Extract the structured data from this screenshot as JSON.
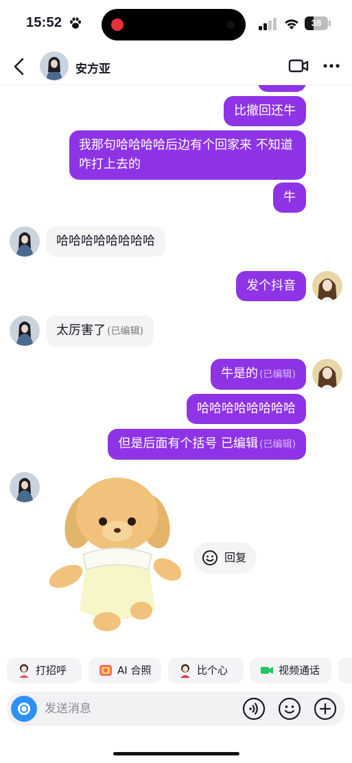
{
  "status_bar": {
    "time": "15:52",
    "battery": "38",
    "battery_fraction": 0.38
  },
  "header": {
    "contact_name": "安方亚",
    "back_icon": "chevron-left-icon",
    "video_icon": "video-camera-icon",
    "more_icon": "more-dots-icon"
  },
  "messages": [
    {
      "side": "sent",
      "text": "比撤回还牛"
    },
    {
      "side": "sent",
      "text": "我那句哈哈哈哈后边有个回家来 不知道咋打上去的"
    },
    {
      "side": "sent",
      "text": "牛"
    },
    {
      "side": "recv",
      "text": "哈哈哈哈哈哈哈哈"
    },
    {
      "side": "sent",
      "text": "发个抖音"
    },
    {
      "side": "recv",
      "text": "太厉害了",
      "tag": "(已编辑)"
    },
    {
      "side": "sent",
      "text": "牛是的",
      "tag": "(已编辑)"
    },
    {
      "side": "sent",
      "text": "哈哈哈哈哈哈哈哈"
    },
    {
      "side": "sent",
      "text": "但是后面有个括号 已编辑",
      "tag": "(已编辑)"
    }
  ],
  "sticker": {
    "icon": "puppy-plush-sticker"
  },
  "reply_chip": {
    "label": "回复",
    "icon": "smile-icon"
  },
  "quick_actions": [
    {
      "label": "打招呼",
      "icon": "wave-avatar-icon"
    },
    {
      "label": "AI 合照",
      "icon": "ai-photo-icon"
    },
    {
      "label": "比个心",
      "icon": "heart-avatar-icon"
    },
    {
      "label": "视频通话",
      "icon": "video-call-icon"
    }
  ],
  "input": {
    "placeholder": "发送消息",
    "value": ""
  },
  "colors": {
    "sent_bubble": "#8e34e6",
    "recv_bubble": "#f4f4f5",
    "camera_button": "#2e91f5",
    "video_call_green": "#22c55e"
  }
}
